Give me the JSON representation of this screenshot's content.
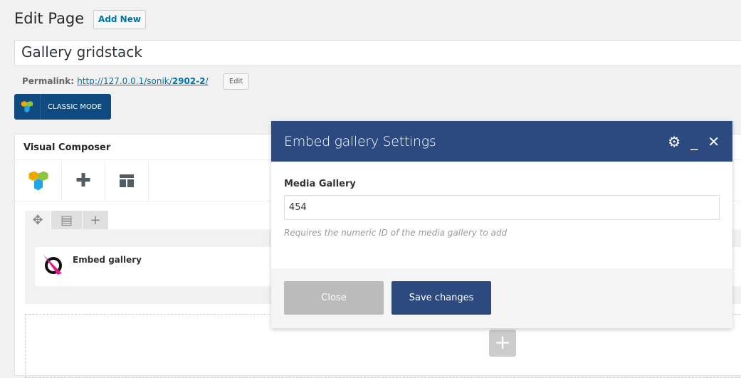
{
  "header": {
    "title": "Edit Page",
    "add_new": "Add New"
  },
  "post": {
    "title": "Gallery gridstack",
    "permalink_label": "Permalink:",
    "permalink_base": "http://127.0.0.1/sonik/",
    "permalink_slug": "2902-2",
    "permalink_trail": "/",
    "edit_label": "Edit"
  },
  "classic_mode": {
    "label": "CLASSIC MODE"
  },
  "composer": {
    "title": "Visual Composer",
    "element_name": "Embed gallery"
  },
  "modal": {
    "title": "Embed gallery Settings",
    "field_label": "Media Gallery",
    "field_value": "454",
    "help": "Requires the numeric ID of the media gallery to add",
    "close_label": "Close",
    "save_label": "Save changes"
  },
  "colors": {
    "modal_header": "#2c4a7f",
    "classic_button": "#0f4a80",
    "link": "#0073aa"
  }
}
